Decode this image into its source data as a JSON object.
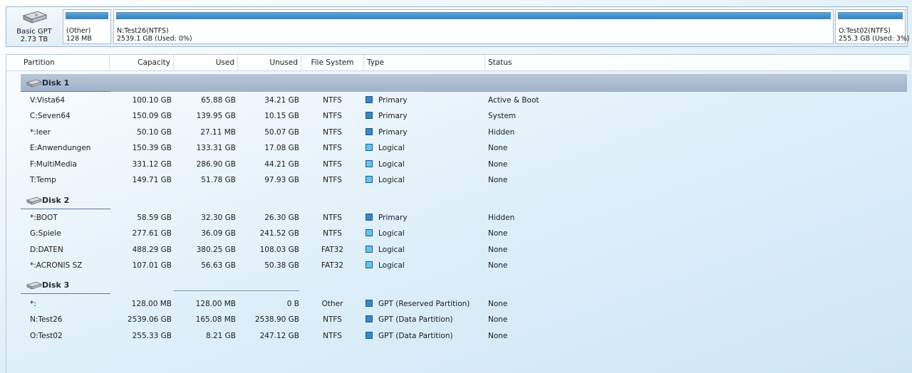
{
  "disk_map": {
    "disk_label": "Basic GPT",
    "disk_size": "2.73 TB",
    "segments": [
      {
        "line1": "(Other)",
        "line2": "128 MB"
      },
      {
        "line1": "N:Test26(NTFS)",
        "line2": "2539.1 GB (Used: 0%)"
      },
      {
        "line1": "O:Test02(NTFS)",
        "line2": "255.3 GB (Used: 3%)"
      }
    ]
  },
  "columns": {
    "partition": "Partition",
    "capacity": "Capacity",
    "used": "Used",
    "unused": "Unused",
    "file_system": "File System",
    "type": "Type",
    "status": "Status"
  },
  "disks": [
    {
      "title": "Disk 1",
      "rows": [
        {
          "partition": "V:Vista64",
          "capacity": "100.10 GB",
          "used": "65.88 GB",
          "unused": "34.21 GB",
          "fs": "NTFS",
          "type": "Primary",
          "status": "Active & Boot"
        },
        {
          "partition": "C:Seven64",
          "capacity": "150.09 GB",
          "used": "139.95 GB",
          "unused": "10.15 GB",
          "fs": "NTFS",
          "type": "Primary",
          "status": "System"
        },
        {
          "partition": "*:leer",
          "capacity": "50.10 GB",
          "used": "27.11 MB",
          "unused": "50.07 GB",
          "fs": "NTFS",
          "type": "Primary",
          "status": "Hidden"
        },
        {
          "partition": "E:Anwendungen",
          "capacity": "150.39 GB",
          "used": "133.31 GB",
          "unused": "17.08 GB",
          "fs": "NTFS",
          "type": "Logical",
          "status": "None"
        },
        {
          "partition": "F:MultiMedia",
          "capacity": "331.12 GB",
          "used": "286.90 GB",
          "unused": "44.21 GB",
          "fs": "NTFS",
          "type": "Logical",
          "status": "None"
        },
        {
          "partition": "T:Temp",
          "capacity": "149.71 GB",
          "used": "51.78 GB",
          "unused": "97.93 GB",
          "fs": "NTFS",
          "type": "Logical",
          "status": "None"
        }
      ]
    },
    {
      "title": "Disk 2",
      "rows": [
        {
          "partition": "*:BOOT",
          "capacity": "58.59 GB",
          "used": "32.30 GB",
          "unused": "26.30 GB",
          "fs": "NTFS",
          "type": "Primary",
          "status": "Hidden"
        },
        {
          "partition": "G:Spiele",
          "capacity": "277.61 GB",
          "used": "36.09 GB",
          "unused": "241.52 GB",
          "fs": "NTFS",
          "type": "Logical",
          "status": "None"
        },
        {
          "partition": "D:DATEN",
          "capacity": "488.29 GB",
          "used": "380.25 GB",
          "unused": "108.03 GB",
          "fs": "FAT32",
          "type": "Logical",
          "status": "None"
        },
        {
          "partition": "*:ACRONIS SZ",
          "capacity": "107.01 GB",
          "used": "56.63 GB",
          "unused": "50.38 GB",
          "fs": "FAT32",
          "type": "Logical",
          "status": "None"
        }
      ]
    },
    {
      "title": "Disk 3",
      "rows": [
        {
          "partition": "*:",
          "capacity": "128.00 MB",
          "used": "128.00 MB",
          "unused": "0 B",
          "fs": "Other",
          "type": "GPT (Reserved Partition)",
          "status": "None"
        },
        {
          "partition": "N:Test26",
          "capacity": "2539.06 GB",
          "used": "165.08 MB",
          "unused": "2538.90 GB",
          "fs": "NTFS",
          "type": "GPT (Data Partition)",
          "status": "None"
        },
        {
          "partition": "O:Test02",
          "capacity": "255.33 GB",
          "used": "8.21 GB",
          "unused": "247.12 GB",
          "fs": "NTFS",
          "type": "GPT (Data Partition)",
          "status": "None"
        }
      ]
    }
  ],
  "colors": {
    "primary_square": "#3b86c4",
    "logical_square": "#68c3ea",
    "selected_group": "#a9bacf"
  },
  "icons": {
    "disk": "hard-disk-icon"
  }
}
